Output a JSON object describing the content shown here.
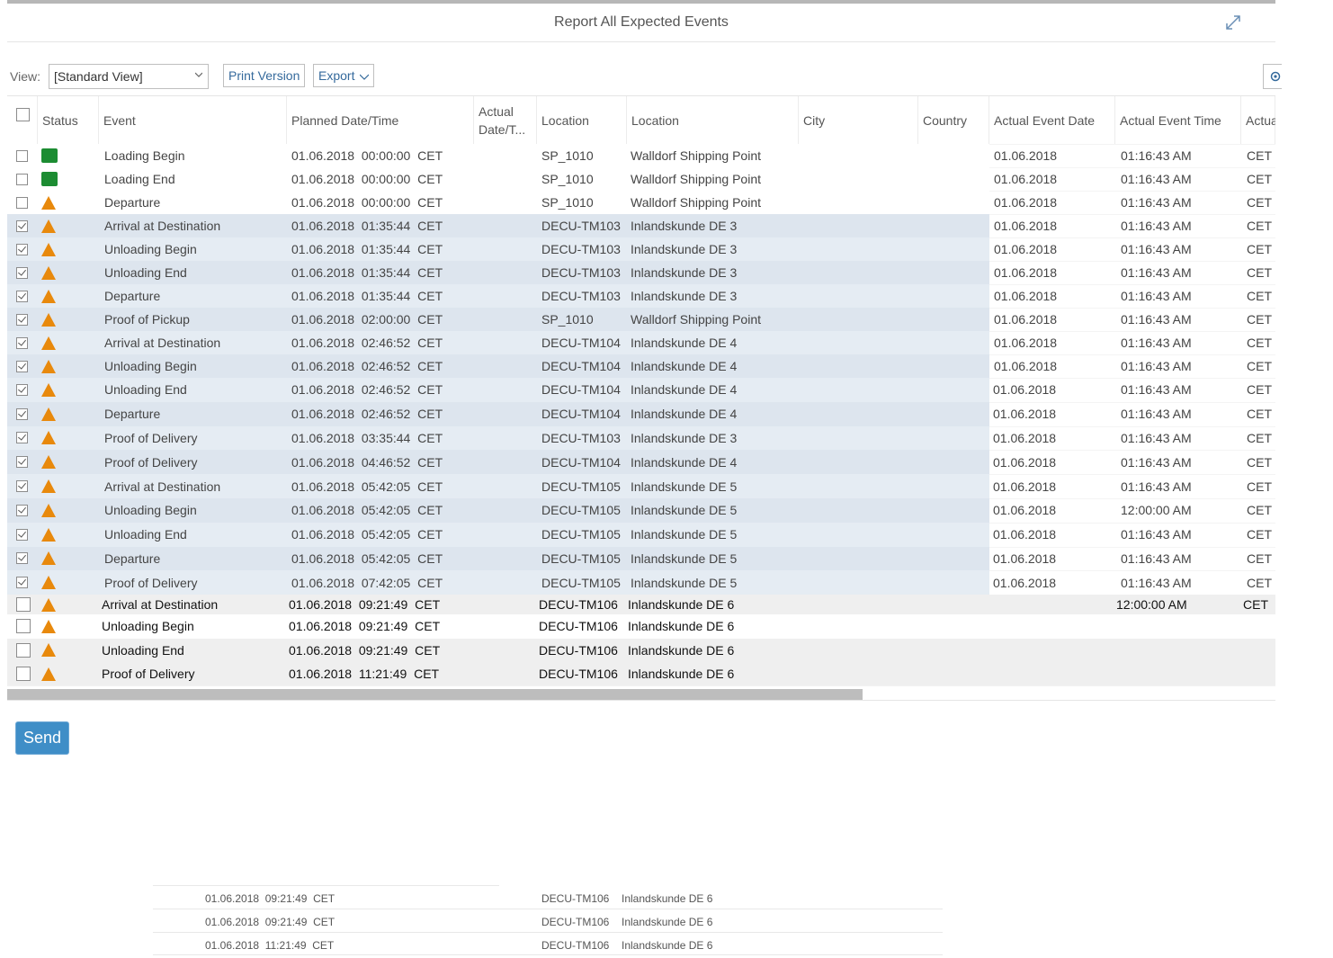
{
  "window": {
    "title": "Report All Expected Events"
  },
  "toolbar": {
    "view_label": "View:",
    "view_value": "[Standard View]",
    "print_label": "Print Version",
    "export_label": "Export"
  },
  "columns": [
    "Status",
    "Event",
    "Planned Date/Time",
    "Actual Date/T...",
    "Location",
    "Location",
    "City",
    "Country",
    "Actual Event Date",
    "Actual Event Time",
    "Actua"
  ],
  "rows": [
    {
      "checked": false,
      "status": "green",
      "event": "Loading Begin",
      "planned": "01.06.2018  00:00:00  CET",
      "loc_id": "SP_1010",
      "loc_name": "Walldorf Shipping Point",
      "act_date": "01.06.2018",
      "act_time": "01:16:43 AM",
      "tz": "CET"
    },
    {
      "checked": false,
      "status": "green",
      "event": "Loading End",
      "planned": "01.06.2018  00:00:00  CET",
      "loc_id": "SP_1010",
      "loc_name": "Walldorf Shipping Point",
      "act_date": "01.06.2018",
      "act_time": "01:16:43 AM",
      "tz": "CET"
    },
    {
      "checked": false,
      "status": "warning",
      "event": "Departure",
      "planned": "01.06.2018  00:00:00  CET",
      "loc_id": "SP_1010",
      "loc_name": "Walldorf Shipping Point",
      "act_date": "01.06.2018",
      "act_time": "01:16:43 AM",
      "tz": "CET"
    },
    {
      "checked": true,
      "status": "warning",
      "event": "Arrival at Destination",
      "planned": "01.06.2018  01:35:44  CET",
      "loc_id": "DECU-TM103",
      "loc_name": "Inlandskunde DE 3",
      "act_date": "01.06.2018",
      "act_time": "01:16:43 AM",
      "tz": "CET"
    },
    {
      "checked": true,
      "status": "warning",
      "event": "Unloading Begin",
      "planned": "01.06.2018  01:35:44  CET",
      "loc_id": "DECU-TM103",
      "loc_name": "Inlandskunde DE 3",
      "act_date": "01.06.2018",
      "act_time": "01:16:43 AM",
      "tz": "CET"
    },
    {
      "checked": true,
      "status": "warning",
      "event": "Unloading End",
      "planned": "01.06.2018  01:35:44  CET",
      "loc_id": "DECU-TM103",
      "loc_name": "Inlandskunde DE 3",
      "act_date": "01.06.2018",
      "act_time": "01:16:43 AM",
      "tz": "CET"
    },
    {
      "checked": true,
      "status": "warning",
      "event": "Departure",
      "planned": "01.06.2018  01:35:44  CET",
      "loc_id": "DECU-TM103",
      "loc_name": "Inlandskunde DE 3",
      "act_date": "01.06.2018",
      "act_time": "01:16:43 AM",
      "tz": "CET"
    },
    {
      "checked": true,
      "status": "warning",
      "event": "Proof of Pickup",
      "planned": "01.06.2018  02:00:00  CET",
      "loc_id": "SP_1010",
      "loc_name": "Walldorf Shipping Point",
      "act_date": "01.06.2018",
      "act_time": "01:16:43 AM",
      "tz": "CET"
    },
    {
      "checked": true,
      "status": "warning",
      "event": "Arrival at Destination",
      "planned": "01.06.2018  02:46:52  CET",
      "loc_id": "DECU-TM104",
      "loc_name": "Inlandskunde DE 4",
      "act_date": "01.06.2018",
      "act_time": "01:16:43 AM",
      "tz": "CET"
    },
    {
      "checked": true,
      "status": "warning",
      "event": "Unloading Begin",
      "planned": "01.06.2018  02:46:52  CET",
      "loc_id": "DECU-TM104",
      "loc_name": "Inlandskunde DE 4",
      "act_date": "01.06.2018",
      "act_time": "01:16:43 AM",
      "tz": "CET"
    },
    {
      "checked": true,
      "status": "warning",
      "event": "Unloading End",
      "planned": "01.06.2018  02:46:52  CET",
      "loc_id": "DECU-TM104",
      "loc_name": "Inlandskunde DE 4",
      "act_date": "01.06.2018",
      "act_time": "01:16:43 AM",
      "tz": "CET"
    },
    {
      "checked": true,
      "status": "warning",
      "event": "Departure",
      "planned": "01.06.2018  02:46:52  CET",
      "loc_id": "DECU-TM104",
      "loc_name": "Inlandskunde DE 4",
      "act_date": "01.06.2018",
      "act_time": "01:16:43 AM",
      "tz": "CET"
    },
    {
      "checked": true,
      "status": "warning",
      "event": "Proof of Delivery",
      "planned": "01.06.2018  03:35:44  CET",
      "loc_id": "DECU-TM103",
      "loc_name": "Inlandskunde DE 3",
      "act_date": "01.06.2018",
      "act_time": "01:16:43 AM",
      "tz": "CET"
    },
    {
      "checked": true,
      "status": "warning",
      "event": "Proof of Delivery",
      "planned": "01.06.2018  04:46:52  CET",
      "loc_id": "DECU-TM104",
      "loc_name": "Inlandskunde DE 4",
      "act_date": "01.06.2018",
      "act_time": "01:16:43 AM",
      "tz": "CET"
    },
    {
      "checked": true,
      "status": "warning",
      "event": "Arrival at Destination",
      "planned": "01.06.2018  05:42:05  CET",
      "loc_id": "DECU-TM105",
      "loc_name": "Inlandskunde DE 5",
      "act_date": "01.06.2018",
      "act_time": "01:16:43 AM",
      "tz": "CET"
    },
    {
      "checked": true,
      "status": "warning",
      "event": "Unloading Begin",
      "planned": "01.06.2018  05:42:05  CET",
      "loc_id": "DECU-TM105",
      "loc_name": "Inlandskunde DE 5",
      "act_date": "01.06.2018",
      "act_time": "12:00:00 AM",
      "tz": "CET"
    },
    {
      "checked": true,
      "status": "warning",
      "event": "Unloading End",
      "planned": "01.06.2018  05:42:05  CET",
      "loc_id": "DECU-TM105",
      "loc_name": "Inlandskunde DE 5",
      "act_date": "01.06.2018",
      "act_time": "01:16:43 AM",
      "tz": "CET"
    },
    {
      "checked": true,
      "status": "warning",
      "event": "Departure",
      "planned": "01.06.2018  05:42:05  CET",
      "loc_id": "DECU-TM105",
      "loc_name": "Inlandskunde DE 5",
      "act_date": "01.06.2018",
      "act_time": "01:16:43 AM",
      "tz": "CET"
    },
    {
      "checked": true,
      "status": "warning",
      "event": "Proof of Delivery",
      "planned": "01.06.2018  07:42:05  CET",
      "loc_id": "DECU-TM105",
      "loc_name": "Inlandskunde DE 5",
      "act_date": "01.06.2018",
      "act_time": "01:16:43 AM",
      "tz": "CET"
    },
    {
      "checked": false,
      "status": "warning",
      "event": "Arrival at Destination",
      "planned": "01.06.2018  09:21:49  CET",
      "loc_id": "DECU-TM106",
      "loc_name": "Inlandskunde DE 6",
      "act_date": "",
      "act_time": "12:00:00 AM",
      "tz": "CET"
    },
    {
      "checked": false,
      "status": "warning",
      "event": "Unloading Begin",
      "planned": "01.06.2018  09:21:49  CET",
      "loc_id": "DECU-TM106",
      "loc_name": "Inlandskunde DE 6",
      "act_date": "",
      "act_time": "",
      "tz": ""
    },
    {
      "checked": false,
      "status": "warning",
      "event": "Unloading End",
      "planned": "01.06.2018  09:21:49  CET",
      "loc_id": "DECU-TM106",
      "loc_name": "Inlandskunde DE 6",
      "act_date": "",
      "act_time": "",
      "tz": ""
    },
    {
      "checked": false,
      "status": "warning",
      "event": "Proof of Delivery",
      "planned": "01.06.2018  11:21:49  CET",
      "loc_id": "DECU-TM106",
      "loc_name": "Inlandskunde DE 6",
      "act_date": "",
      "act_time": "",
      "tz": ""
    }
  ],
  "send_label": "Send",
  "snippet_rows": [
    {
      "planned": "01.06.2018  09:21:49  CET",
      "loc_id": "DECU-TM106",
      "loc_name": "Inlandskunde DE 6"
    },
    {
      "planned": "01.06.2018  09:21:49  CET",
      "loc_id": "DECU-TM106",
      "loc_name": "Inlandskunde DE 6"
    },
    {
      "planned": "01.06.2018  11:21:49  CET",
      "loc_id": "DECU-TM106",
      "loc_name": "Inlandskunde DE 6"
    }
  ],
  "colors": {
    "selected_row": "#e5ecf3",
    "status_ok": "#1c8c32",
    "status_warning": "#e8890c",
    "send_button": "#3f8ec7"
  },
  "icons": {
    "expand": "expand-icon",
    "settings": "settings-icon",
    "dropdown": "chevron-down-icon"
  }
}
